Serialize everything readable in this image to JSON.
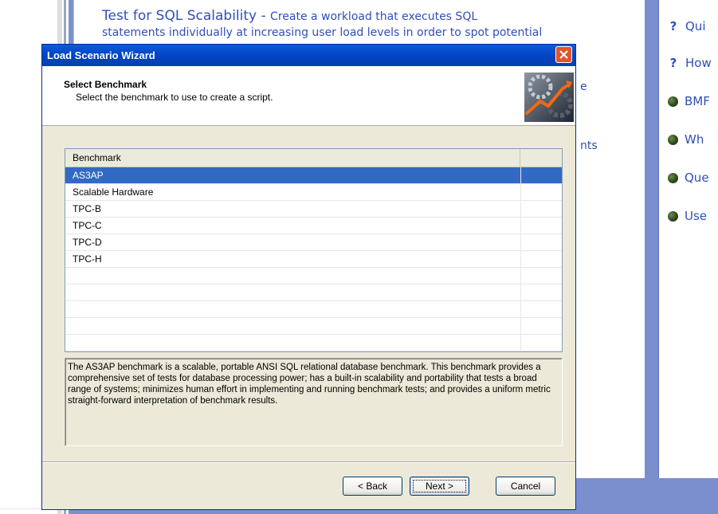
{
  "background_app": {
    "title": "Test for SQL Scalability",
    "title_sep": " - ",
    "title_desc": "Create a workload that executes SQL",
    "second_line": "statements individually at increasing user load levels in order to spot potential",
    "fragment_e": "e",
    "fragment_nts": "nts",
    "side_links": [
      {
        "icon": "question-icon",
        "text": "Qui"
      },
      {
        "icon": "question-icon",
        "text": "How"
      },
      {
        "icon": "globe-icon",
        "text": "BMF"
      },
      {
        "icon": "globe-icon",
        "text": "Wh"
      },
      {
        "icon": "globe-icon",
        "text": "Que"
      },
      {
        "icon": "globe-icon",
        "text": "Use"
      }
    ]
  },
  "dialog": {
    "title": "Load Scenario Wizard",
    "header": {
      "title": "Select Benchmark",
      "subtitle": "Select the benchmark to use to create a script."
    },
    "list": {
      "columns": [
        "Benchmark",
        ""
      ],
      "rows": [
        "AS3AP",
        "Scalable Hardware",
        "TPC-B",
        "TPC-C",
        "TPC-D",
        "TPC-H",
        "",
        "",
        "",
        "",
        ""
      ],
      "selected_index": 0
    },
    "description": "The AS3AP benchmark is a scalable, portable ANSI SQL relational database benchmark.  This benchmark provides a comprehensive set of tests for database processing power; has a built-in scalability and portability that tests a broad range of systems; minimizes human effort in implementing and running benchmark tests; and provides a uniform metric straight-forward interpretation of benchmark results.",
    "buttons": {
      "back": "< Back",
      "next": "Next >",
      "cancel": "Cancel"
    }
  },
  "colors": {
    "titlebar": "#0a5cd8",
    "selection": "#316ac5",
    "link": "#2f4fb8",
    "dialog_face": "#ece9d8"
  }
}
